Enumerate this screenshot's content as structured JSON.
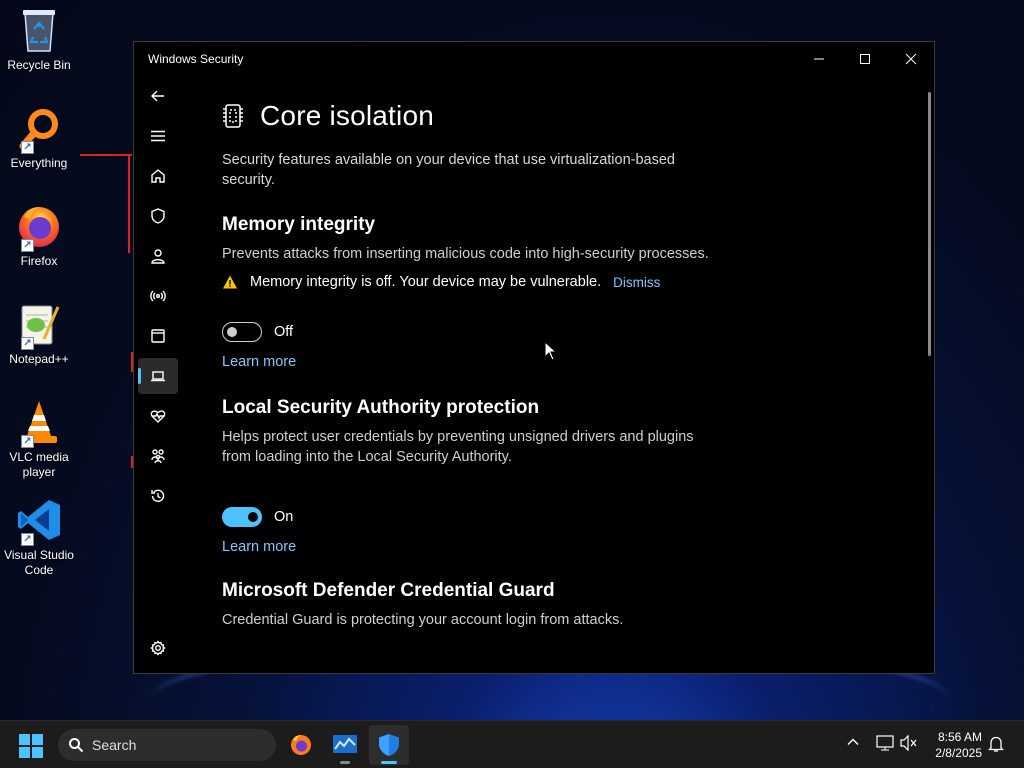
{
  "desktop": {
    "icons": [
      {
        "label": "Recycle Bin"
      },
      {
        "label": "Everything"
      },
      {
        "label": "Firefox"
      },
      {
        "label": "Notepad++"
      },
      {
        "label": "VLC media player"
      },
      {
        "label": "Visual Studio Code"
      }
    ]
  },
  "window": {
    "title": "Windows Security",
    "nav": [
      {
        "icon": "back-arrow-icon"
      },
      {
        "icon": "hamburger-menu-icon"
      },
      {
        "icon": "home-icon"
      },
      {
        "icon": "shield-icon"
      },
      {
        "icon": "person-icon"
      },
      {
        "icon": "wireless-icon"
      },
      {
        "icon": "browser-window-icon"
      },
      {
        "icon": "laptop-icon",
        "selected": true
      },
      {
        "icon": "heart-pulse-icon"
      },
      {
        "icon": "family-icon"
      },
      {
        "icon": "history-icon"
      },
      {
        "icon": "gear-icon"
      }
    ]
  },
  "page": {
    "title": "Core isolation",
    "intro": "Security features available on your device that use virtualization-based security.",
    "memory_integrity": {
      "title": "Memory integrity",
      "description": "Prevents attacks from inserting malicious code into high-security processes.",
      "warning": "Memory integrity is off. Your device may be vulnerable.",
      "dismiss": "Dismiss",
      "toggle_state": "Off",
      "learn_more": "Learn more"
    },
    "lsa": {
      "title": "Local Security Authority protection",
      "description": "Helps protect user credentials by preventing unsigned drivers and plugins from loading into the Local Security Authority.",
      "toggle_state": "On",
      "learn_more": "Learn more"
    },
    "credential_guard": {
      "title": "Microsoft Defender Credential Guard",
      "description": "Credential Guard is protecting your account login from attacks."
    }
  },
  "taskbar": {
    "search_label": "Search",
    "time": "8:56 AM",
    "date": "2/8/2025"
  },
  "colors": {
    "accent": "#4cc2ff",
    "link": "#7fc7ff",
    "warning": "#f5c400"
  }
}
